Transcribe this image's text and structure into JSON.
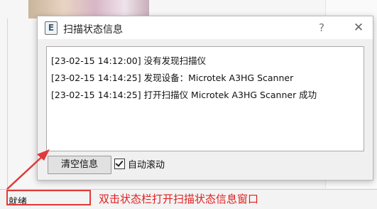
{
  "dialog": {
    "title": "扫描状态信息",
    "icon_letter": "E",
    "help_symbol": "?",
    "close_symbol": "✕"
  },
  "log": {
    "lines": [
      "[23-02-15 14:12:00]  没有发现扫描仪",
      "[23-02-15 14:14:25]  发现设备：Microtek A3HG Scanner",
      "[23-02-15 14:14:25]  打开扫描仪 Microtek A3HG Scanner 成功"
    ]
  },
  "controls": {
    "clear_button": "清空信息",
    "auto_scroll_label": "自动滚动",
    "auto_scroll_checked": true
  },
  "statusbar": {
    "text": "就绪"
  },
  "annotation": {
    "text": "双击状态栏打开扫描状态信息窗口",
    "color": "#e02020"
  }
}
